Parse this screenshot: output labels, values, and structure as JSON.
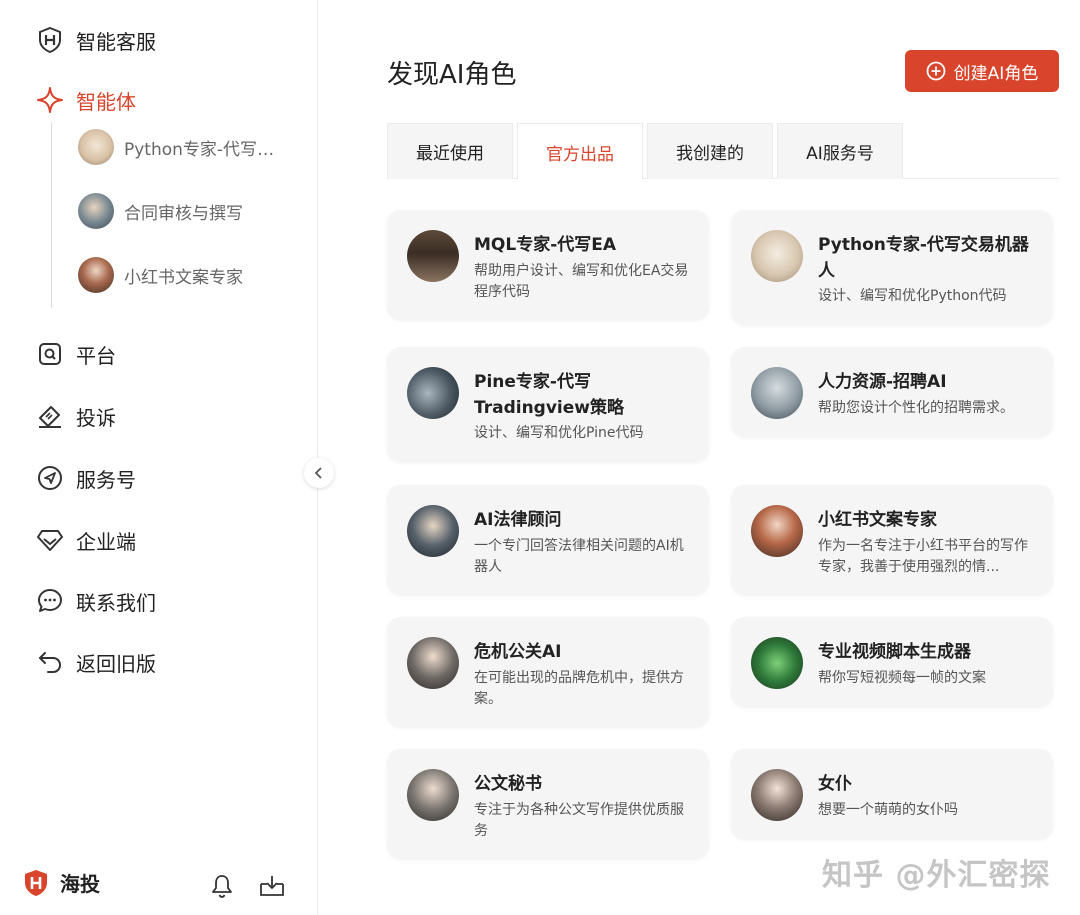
{
  "sidebar": {
    "items": [
      {
        "label": "智能客服",
        "icon": "shield-icon"
      },
      {
        "label": "智能体",
        "icon": "sparkle-icon"
      },
      {
        "label": "平台",
        "icon": "search-box-icon"
      },
      {
        "label": "投诉",
        "icon": "ticket-icon"
      },
      {
        "label": "服务号",
        "icon": "send-icon"
      },
      {
        "label": "企业端",
        "icon": "diamond-icon"
      },
      {
        "label": "联系我们",
        "icon": "chat-bubble-icon"
      },
      {
        "label": "返回旧版",
        "icon": "undo-icon"
      }
    ],
    "sub_items": [
      {
        "label": "Python专家-代写交易机器人"
      },
      {
        "label": "合同审核与撰写"
      },
      {
        "label": "小红书文案专家"
      }
    ],
    "footer": {
      "brand": "海投",
      "icons": [
        "bell-icon",
        "inbox-download-icon"
      ]
    }
  },
  "main": {
    "title": "发现AI角色",
    "create_button": "创建AI角色",
    "tabs": [
      {
        "label": "最近使用"
      },
      {
        "label": "官方出品"
      },
      {
        "label": "我创建的"
      },
      {
        "label": "AI服务号"
      }
    ],
    "active_tab": "官方出品",
    "cards": [
      {
        "title": "MQL专家-代写EA",
        "desc": "帮助用户设计、编写和优化EA交易程序代码"
      },
      {
        "title": "Python专家-代写交易机器人",
        "desc": "设计、编写和优化Python代码"
      },
      {
        "title": "Pine专家-代写Tradingview策略",
        "desc": "设计、编写和优化Pine代码"
      },
      {
        "title": "人力资源-招聘AI",
        "desc": "帮助您设计个性化的招聘需求。"
      },
      {
        "title": "AI法律顾问",
        "desc": "一个专门回答法律相关问题的AI机器人"
      },
      {
        "title": "小红书文案专家",
        "desc": "作为一名专注于小红书平台的写作专家，我善于使用强烈的情..."
      },
      {
        "title": "危机公关AI",
        "desc": "在可能出现的品牌危机中，提供方案。"
      },
      {
        "title": "专业视频脚本生成器",
        "desc": "帮你写短视频每一帧的文案"
      },
      {
        "title": "公文秘书",
        "desc": "专注于为各种公文写作提供优质服务"
      },
      {
        "title": "女仆",
        "desc": "想要一个萌萌的女仆吗"
      }
    ]
  },
  "watermark": "知乎 @外汇密探",
  "colors": {
    "accent": "#d9452c",
    "card_bg": "#f5f5f5",
    "muted_text": "#666666"
  }
}
